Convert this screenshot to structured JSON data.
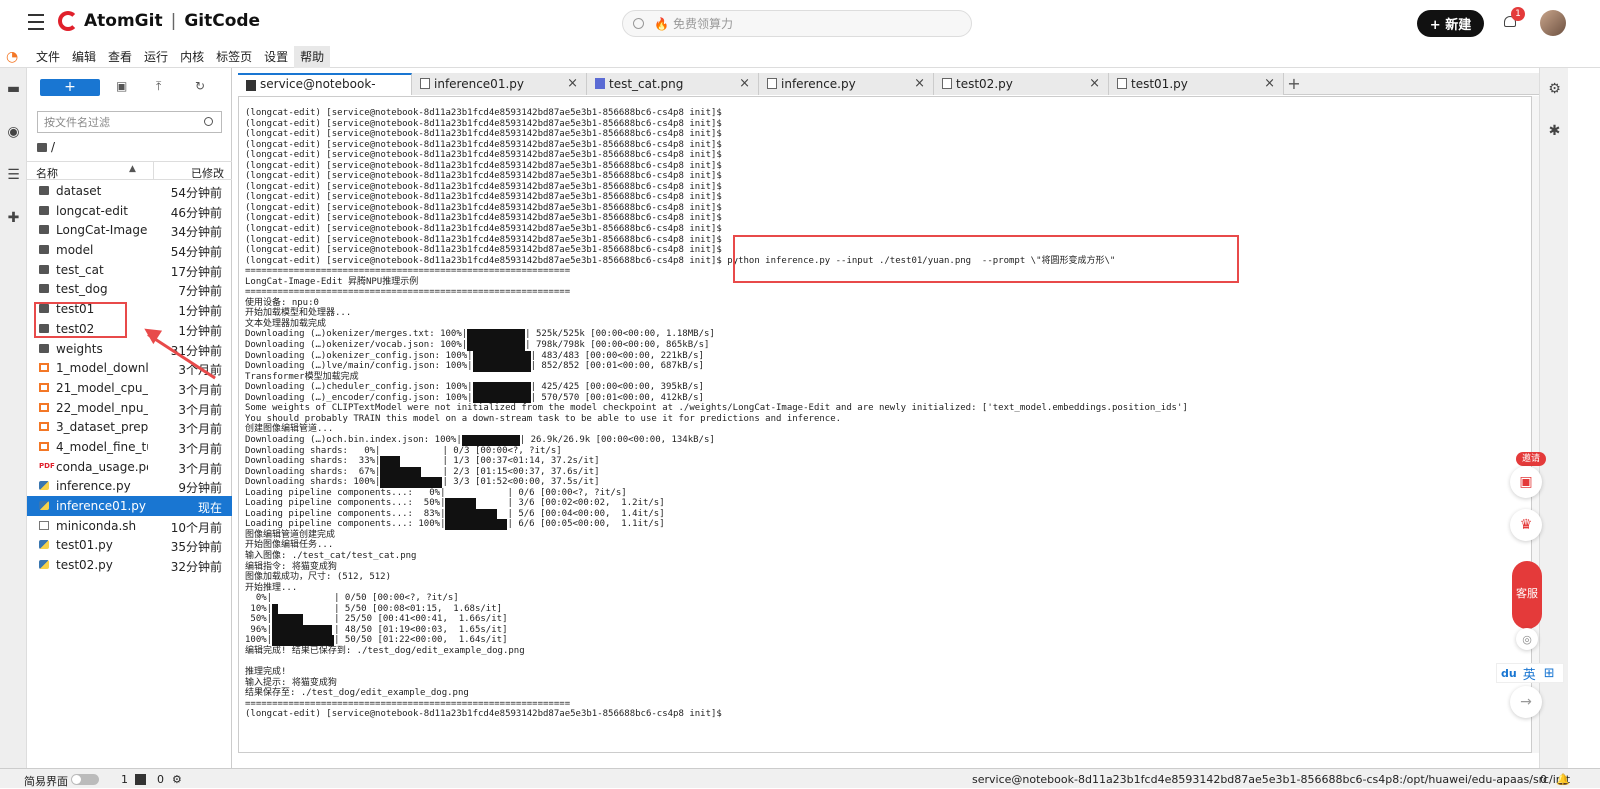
{
  "topbar": {
    "brand_a": "AtomGit",
    "brand_sep": "|",
    "brand_b": "GitCode",
    "search_placeholder": "免费领算力",
    "new_label": "+ 新建",
    "notif_count": "1"
  },
  "menu": [
    "文件",
    "编辑",
    "查看",
    "运行",
    "内核",
    "标签页",
    "设置",
    "帮助"
  ],
  "filepanel": {
    "new_label": "+",
    "filter_placeholder": "按文件名过滤",
    "path": "/",
    "col_name": "名称",
    "col_modified": "已修改",
    "rows": [
      {
        "name": "dataset",
        "mod": "54分钟前",
        "type": "folder"
      },
      {
        "name": "longcat-edit",
        "mod": "46分钟前",
        "type": "folder"
      },
      {
        "name": "LongCat-Image",
        "mod": "34分钟前",
        "type": "folder"
      },
      {
        "name": "model",
        "mod": "54分钟前",
        "type": "folder"
      },
      {
        "name": "test_cat",
        "mod": "17分钟前",
        "type": "folder"
      },
      {
        "name": "test_dog",
        "mod": "7分钟前",
        "type": "folder"
      },
      {
        "name": "test01",
        "mod": "1分钟前",
        "type": "folder"
      },
      {
        "name": "test02",
        "mod": "1分钟前",
        "type": "folder"
      },
      {
        "name": "weights",
        "mod": "31分钟前",
        "type": "folder"
      },
      {
        "name": "1_model_downl...",
        "mod": "3个月前",
        "type": "nb"
      },
      {
        "name": "21_model_cpu_i...",
        "mod": "3个月前",
        "type": "nb"
      },
      {
        "name": "22_model_npu_i...",
        "mod": "3个月前",
        "type": "nb"
      },
      {
        "name": "3_dataset_prepa...",
        "mod": "3个月前",
        "type": "nb"
      },
      {
        "name": "4_model_fine_tu...",
        "mod": "3个月前",
        "type": "nb"
      },
      {
        "name": "conda_usage.pdf",
        "mod": "3个月前",
        "type": "pdf"
      },
      {
        "name": "inference.py",
        "mod": "9分钟前",
        "type": "py"
      },
      {
        "name": "inference01.py",
        "mod": "现在",
        "type": "py",
        "selected": true
      },
      {
        "name": "miniconda.sh",
        "mod": "10个月前",
        "type": "sh"
      },
      {
        "name": "test01.py",
        "mod": "35分钟前",
        "type": "py"
      },
      {
        "name": "test02.py",
        "mod": "32分钟前",
        "type": "py"
      }
    ]
  },
  "tabs": [
    {
      "label": "service@notebook-8d11a",
      "icon": "terminal"
    },
    {
      "label": "inference01.py",
      "icon": "doc"
    },
    {
      "label": "test_cat.png",
      "icon": "image"
    },
    {
      "label": "inference.py",
      "icon": "doc"
    },
    {
      "label": "test02.py",
      "icon": "doc"
    },
    {
      "label": "test01.py",
      "icon": "doc"
    }
  ],
  "terminal": {
    "prompt": "(longcat-edit) [service@notebook-8d11a23b1fcd4e8593142bd87ae5e3b1-856688bc6-cs4p8 init]$",
    "command": " python inference.py --input ./test01/yuan.png  --prompt \\\"将圆形变成方形\\\"",
    "sep": "============================================================",
    "lines": [
      "LongCat-Image-Edit 昇腾NPU推理示例",
      "使用设备: npu:0",
      "开始加载模型和处理器...",
      "文本处理器加载完成",
      "Downloading (…)okenizer/merges.txt: 100%|",
      "Downloading (…)okenizer/vocab.json: 100%|",
      "Downloading (…)okenizer_config.json: 100%|",
      "Downloading (…)lve/main/config.json: 100%|",
      "Transformer模型加载完成",
      "Downloading (…)cheduler_config.json: 100%|",
      "Downloading (…)_encoder/config.json: 100%|",
      "Some weights of CLIPTextModel were not initialized from the model checkpoint at ./weights/LongCat-Image-Edit and are newly initialized: ['text_model.embeddings.position_ids']",
      "You should probably TRAIN this model on a down-stream task to be able to use it for predictions and inference.",
      "创建图像编辑管道...",
      "Downloading (…)och.bin.index.json: 100%|",
      "Downloading shards:   0%|",
      "Downloading shards:  33%|",
      "Downloading shards:  67%|",
      "Downloading shards: 100%|",
      "Loading pipeline components...:   0%|",
      "Loading pipeline components...:  50%|",
      "Loading pipeline components...:  83%|",
      "Loading pipeline components...: 100%|",
      "图像编辑管道创建完成",
      "开始图像编辑任务...",
      "输入图像: ./test_cat/test_cat.png",
      "编辑指令: 将猫变成狗",
      "图像加载成功，尺寸: (512, 512)",
      "开始推理...",
      "  0%|",
      " 10%|",
      " 50%|",
      " 96%|",
      "100%|",
      "编辑完成! 结果已保存到: ./test_dog/edit_example_dog.png",
      "",
      "推理完成!",
      "输入提示: 将猫变成狗",
      "结果保存至: ./test_dog/edit_example_dog.png"
    ],
    "tails": [
      "| 525k/525k [00:00<00:00, 1.18MB/s]",
      "| 798k/798k [00:00<00:00, 865kB/s]",
      "| 483/483 [00:00<00:00, 221kB/s]",
      "| 852/852 [00:01<00:00, 687kB/s]",
      "| 425/425 [00:00<00:00, 395kB/s]",
      "| 570/570 [00:01<00:00, 412kB/s]",
      "| 26.9k/26.9k [00:00<00:00, 134kB/s]",
      "| 0/3 [00:00<?, ?it/s]",
      "| 1/3 [00:37<01:14, 37.2s/it]",
      "| 2/3 [01:15<00:37, 37.6s/it]",
      "| 3/3 [01:52<00:00, 37.5s/it]",
      "| 0/6 [00:00<?, ?it/s]",
      "| 3/6 [00:02<00:02,  1.2it/s]",
      "| 5/6 [00:04<00:00,  1.4it/s]",
      "| 6/6 [00:05<00:00,  1.1it/s]",
      "| 0/50 [00:00<?, ?it/s]",
      "| 5/50 [00:08<01:15,  1.68s/it]",
      "| 25/50 [00:41<00:41,  1.66s/it]",
      "| 48/50 [01:19<00:03,  1.65s/it]",
      "| 50/50 [01:22<00:00,  1.64s/it]"
    ]
  },
  "right": {
    "invite": "邀请",
    "kefu": "客服",
    "ime_a": "英"
  },
  "status": {
    "mode_label": "简易界面",
    "count_a": "1",
    "count_b": "0",
    "path": "service@notebook-8d11a23b1fcd4e8593142bd87ae5e3b1-856688bc6-cs4p8:/opt/huawei/edu-apaas/src/init",
    "right_count": "0"
  }
}
